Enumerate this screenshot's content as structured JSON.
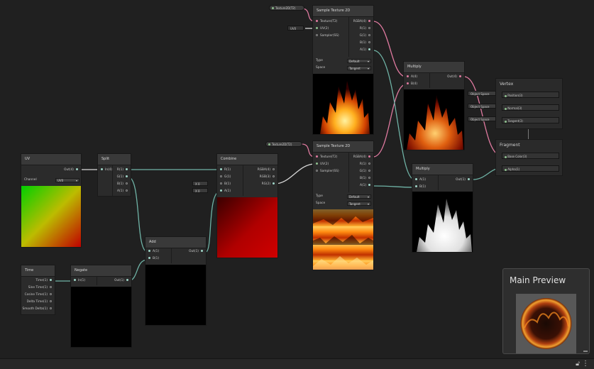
{
  "properties": {
    "texture_a": "Texture2D(T2)",
    "texture_b": "Texture2D(T2)",
    "uv_chip": "UV0"
  },
  "nodes": {
    "uv": {
      "title": "UV",
      "out": "Out(4)",
      "channel_label": "Channel",
      "channel_value": "UV0"
    },
    "split": {
      "title": "Split",
      "in": "In(4)",
      "outs": [
        "R(1)",
        "G(1)",
        "B(1)",
        "A(1)"
      ]
    },
    "combine": {
      "title": "Combine",
      "ins": [
        "R(1)",
        "G(1)",
        "B(1)",
        "A(1)"
      ],
      "outs": [
        "RGBA(4)",
        "RGB(3)",
        "RG(2)"
      ],
      "b_field": "X 0",
      "a_field": "X 0"
    },
    "sample1": {
      "title": "Sample Texture 2D",
      "ins": [
        "Texture(T2)",
        "UV(2)",
        "Sampler(SS)"
      ],
      "outs": [
        "RGBA(4)",
        "R(1)",
        "G(1)",
        "B(1)",
        "A(1)"
      ],
      "type_label": "Type",
      "type_value": "Default",
      "space_label": "Space",
      "space_value": "Tangent"
    },
    "sample2": {
      "title": "Sample Texture 2D",
      "ins": [
        "Texture(T2)",
        "UV(2)",
        "Sampler(SS)"
      ],
      "outs": [
        "RGBA(4)",
        "R(1)",
        "G(1)",
        "B(1)",
        "A(1)"
      ],
      "type_label": "Type",
      "type_value": "Default",
      "space_label": "Space",
      "space_value": "Tangent"
    },
    "multiply1": {
      "title": "Multiply",
      "ins": [
        "A(4)",
        "B(4)"
      ],
      "out": "Out(4)"
    },
    "multiply2": {
      "title": "Multiply",
      "ins": [
        "A(1)",
        "B(1)"
      ],
      "out": "Out(1)"
    },
    "add": {
      "title": "Add",
      "ins": [
        "A(1)",
        "B(1)"
      ],
      "out": "Out(1)"
    },
    "time": {
      "title": "Time",
      "outs": [
        "Time(1)",
        "Sine Time(1)",
        "Cosine Time(1)",
        "Delta Time(1)",
        "Smooth Delta(1)"
      ]
    },
    "negate": {
      "title": "Negate",
      "in": "In(1)",
      "out": "Out(1)"
    }
  },
  "master": {
    "vertex": {
      "title": "Vertex",
      "ports": [
        "Position(3)",
        "Normal(3)",
        "Tangent(3)"
      ],
      "chips": [
        "Object Space",
        "Object Space",
        "Object Space"
      ]
    },
    "fragment": {
      "title": "Fragment",
      "ports": [
        "Base Color(3)",
        "Alpha(1)"
      ]
    }
  },
  "main_preview": {
    "title": "Main Preview"
  },
  "colors": {
    "canvas": "#202020",
    "node": "#2b2b2b",
    "header": "#393939",
    "wire_float": "#6fb3a6",
    "wire_vec": "#e07aa0"
  }
}
